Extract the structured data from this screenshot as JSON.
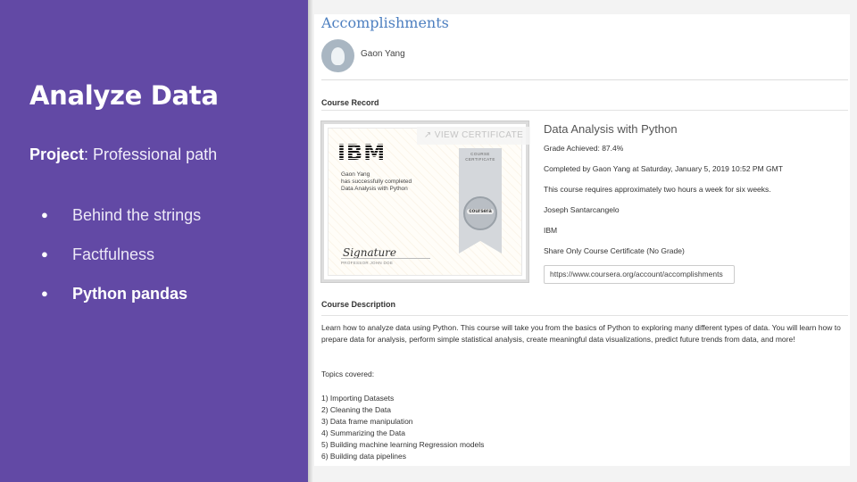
{
  "slide": {
    "title": "Analyze Data",
    "project_label": "Project",
    "project_value": ": Professional path",
    "bullets": [
      {
        "label": "Behind the strings",
        "active": false
      },
      {
        "label": "Factfulness",
        "active": false
      },
      {
        "label": "Python pandas",
        "active": true
      }
    ]
  },
  "accomplishments": {
    "heading": "Accomplishments",
    "user_name": "Gaon Yang",
    "course_record_label": "Course Record",
    "view_certificate": "VIEW CERTIFICATE",
    "certificate": {
      "brand": "IBM",
      "label": "COURSE CERTIFICATE",
      "name": "Gaon Yang",
      "completed_line": "has successfully completed",
      "course": "Data Analysis with Python",
      "signature": "Signature",
      "signer": "PROFESSOR JOHN DOE",
      "seal": "coursera"
    },
    "course_title": "Data Analysis with Python",
    "grade": "Grade Achieved: 87.4%",
    "completed": "Completed by Gaon Yang at Saturday, January 5, 2019 10:52 PM GMT",
    "duration": "This course requires approximately two hours a week for six weeks.",
    "instructor": "Joseph Santarcangelo",
    "org": "IBM",
    "share_label": "Share Only Course Certificate (No Grade)",
    "share_url": "https://www.coursera.org/account/accomplishments",
    "course_description_label": "Course Description",
    "description": "Learn how to analyze data using Python. This course will take you from the basics of Python to exploring many different types of data. You will learn how to prepare data for analysis, perform simple statistical analysis, create meaningful data visualizations, predict future trends from data, and more!",
    "topics_label": "Topics covered:",
    "topics": [
      "1) Importing Datasets",
      "2) Cleaning the Data",
      "3) Data frame manipulation",
      "4) Summarizing the Data",
      "5) Building machine learning Regression models",
      "6) Building data pipelines"
    ]
  },
  "colors": {
    "slide_bg": "#6249a5",
    "heading_blue": "#4d7fc0"
  }
}
